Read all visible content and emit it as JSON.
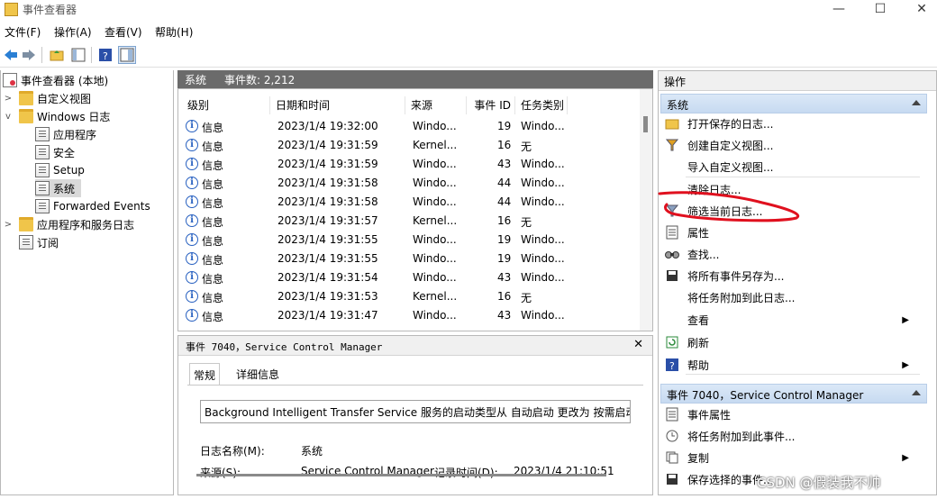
{
  "window": {
    "title": "事件查看器",
    "controls": [
      "—",
      "☐",
      "✕"
    ]
  },
  "menubar": [
    "文件(F)",
    "操作(A)",
    "查看(V)",
    "帮助(H)"
  ],
  "toolbar": {
    "icons": [
      "back-arrow-icon",
      "forward-arrow-icon",
      "up-folder-icon",
      "console-tree-icon",
      "help-icon",
      "action-pane-icon"
    ]
  },
  "tree": {
    "root": "事件查看器 (本地)",
    "custom_views": "自定义视图",
    "windows_logs": "Windows 日志",
    "logs": [
      "应用程序",
      "安全",
      "Setup",
      "系统",
      "Forwarded Events"
    ],
    "apps_services": "应用程序和服务日志",
    "subscriptions": "订阅"
  },
  "center": {
    "log_name": "系统",
    "event_count": "事件数: 2,212"
  },
  "columns": [
    "级别",
    "日期和时间",
    "来源",
    "事件 ID",
    "任务类别"
  ],
  "events": [
    {
      "level": "信息",
      "datetime": "2023/1/4 19:32:00",
      "source": "Windo...",
      "id": "19",
      "category": "Windo..."
    },
    {
      "level": "信息",
      "datetime": "2023/1/4 19:31:59",
      "source": "Kernel...",
      "id": "16",
      "category": "无"
    },
    {
      "level": "信息",
      "datetime": "2023/1/4 19:31:59",
      "source": "Windo...",
      "id": "43",
      "category": "Windo..."
    },
    {
      "level": "信息",
      "datetime": "2023/1/4 19:31:58",
      "source": "Windo...",
      "id": "44",
      "category": "Windo..."
    },
    {
      "level": "信息",
      "datetime": "2023/1/4 19:31:58",
      "source": "Windo...",
      "id": "44",
      "category": "Windo..."
    },
    {
      "level": "信息",
      "datetime": "2023/1/4 19:31:57",
      "source": "Kernel...",
      "id": "16",
      "category": "无"
    },
    {
      "level": "信息",
      "datetime": "2023/1/4 19:31:55",
      "source": "Windo...",
      "id": "19",
      "category": "Windo..."
    },
    {
      "level": "信息",
      "datetime": "2023/1/4 19:31:55",
      "source": "Windo...",
      "id": "19",
      "category": "Windo..."
    },
    {
      "level": "信息",
      "datetime": "2023/1/4 19:31:54",
      "source": "Windo...",
      "id": "43",
      "category": "Windo..."
    },
    {
      "level": "信息",
      "datetime": "2023/1/4 19:31:53",
      "source": "Kernel...",
      "id": "16",
      "category": "无"
    },
    {
      "level": "信息",
      "datetime": "2023/1/4 19:31:47",
      "source": "Windo...",
      "id": "43",
      "category": "Windo..."
    }
  ],
  "detail": {
    "header": "事件 7040，Service Control Manager",
    "close": "✕",
    "tabs": [
      "常规",
      "详细信息"
    ],
    "description": "Background Intelligent Transfer Service 服务的启动类型从 自动启动 更改为 按需启动",
    "log_name_label": "日志名称(M):",
    "log_name_value": "系统",
    "source_label": "来源(S):",
    "source_value": "Service Control Manager",
    "logged_label": "记录时间(D):",
    "logged_value": "2023/1/4 21:10:51"
  },
  "actions": {
    "title": "操作",
    "section1": "系统",
    "items1": [
      "打开保存的日志...",
      "创建自定义视图...",
      "导入自定义视图...",
      "清除日志...",
      "筛选当前日志...",
      "属性",
      "查找...",
      "将所有事件另存为...",
      "将任务附加到此日志...",
      "查看",
      "刷新",
      "帮助"
    ],
    "section2": "事件 7040，Service Control Manager",
    "items2": [
      "事件属性",
      "将任务附加到此事件...",
      "复制",
      "保存选择的事件..."
    ]
  },
  "watermark": "CSDN @假装我不帅",
  "colors": {
    "header_gray": "#6b6b6b",
    "section_blue": "#c7daf1",
    "annotation_red": "#e0101e",
    "info_blue": "#2760c0"
  }
}
